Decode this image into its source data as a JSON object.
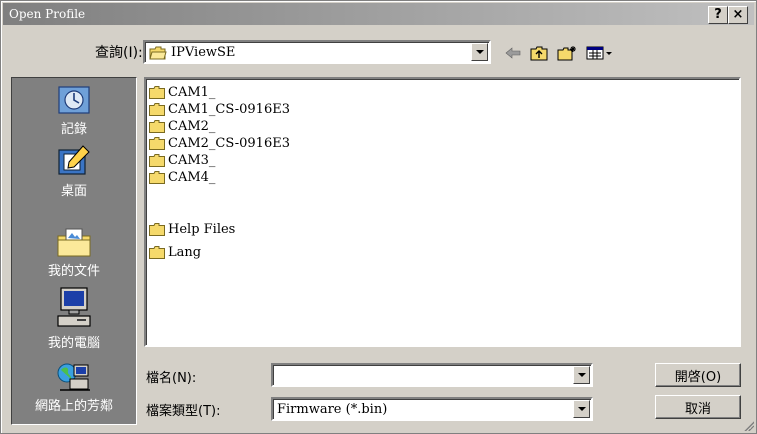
{
  "window": {
    "title": "Open Profile",
    "help_label": "?",
    "close_label": "×"
  },
  "lookin": {
    "label": "查詢(I):",
    "value": "IPViewSE"
  },
  "toolbar": {
    "back_icon": "back-arrow-icon",
    "up_icon": "up-folder-icon",
    "new_folder_icon": "new-folder-icon",
    "view_menu_icon": "view-menu-icon"
  },
  "places": [
    {
      "label": "記錄",
      "icon": "history-icon"
    },
    {
      "label": "桌面",
      "icon": "desktop-icon"
    },
    {
      "label": "我的文件",
      "icon": "my-documents-icon"
    },
    {
      "label": "我的電腦",
      "icon": "my-computer-icon"
    },
    {
      "label": "網路上的芳鄰",
      "icon": "network-icon"
    }
  ],
  "files": [
    "CAM1_",
    "CAM1_CS-0916E3",
    "CAM2_",
    "CAM2_CS-0916E3",
    "CAM3_",
    "CAM4_",
    "Help Files",
    "Lang"
  ],
  "filename": {
    "label": "檔名(N):",
    "value": ""
  },
  "filetype": {
    "label": "檔案類型(T):",
    "value": "Firmware (*.bin)"
  },
  "buttons": {
    "open": "開啓(O)",
    "cancel": "取消"
  },
  "colors": {
    "folder": "#f5d96b",
    "places_bg": "#808080",
    "title_start": "#7f7f7f",
    "title_end": "#c0c0c0"
  }
}
